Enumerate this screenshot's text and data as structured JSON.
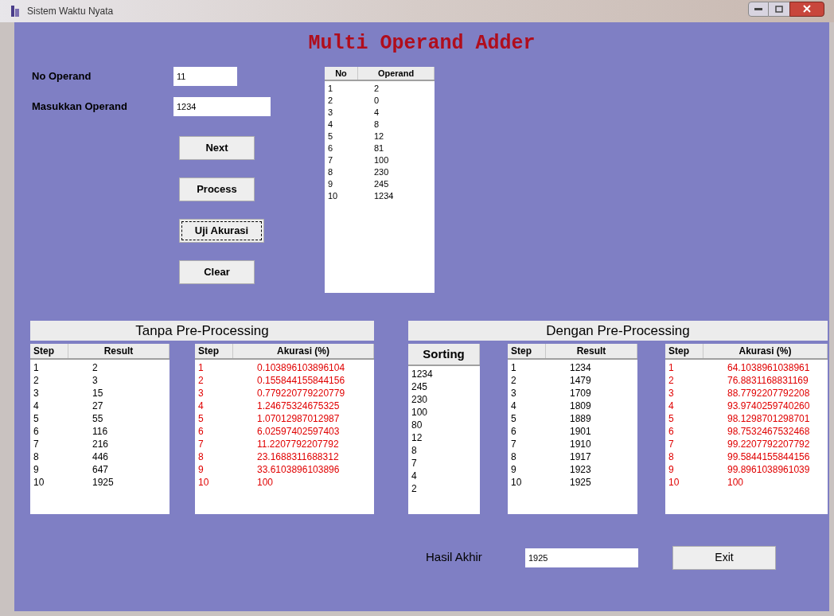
{
  "window": {
    "title": "Sistem Waktu Nyata"
  },
  "title": "Multi Operand Adder",
  "form": {
    "fields": [
      {
        "label": "No Operand",
        "value": "11"
      },
      {
        "label": "Masukkan Operand",
        "value": "1234"
      }
    ],
    "buttons": [
      {
        "label": "Next",
        "focused": false
      },
      {
        "label": "Process",
        "focused": false
      },
      {
        "label": "Uji Akurasi",
        "focused": true
      },
      {
        "label": "Clear",
        "focused": false
      }
    ]
  },
  "operand_list": {
    "columns": [
      "No",
      "Operand"
    ],
    "rows": [
      [
        "1",
        "2"
      ],
      [
        "2",
        "0"
      ],
      [
        "3",
        "4"
      ],
      [
        "4",
        "8"
      ],
      [
        "5",
        "12"
      ],
      [
        "6",
        "81"
      ],
      [
        "7",
        "100"
      ],
      [
        "8",
        "230"
      ],
      [
        "9",
        "245"
      ],
      [
        "10",
        "1234"
      ]
    ]
  },
  "groups": [
    {
      "title": "Tanpa Pre-Processing",
      "tables": [
        {
          "kind": "result",
          "columns": [
            "Step",
            "Result"
          ],
          "rows": [
            [
              "1",
              "2"
            ],
            [
              "2",
              "3"
            ],
            [
              "3",
              "15"
            ],
            [
              "4",
              "27"
            ],
            [
              "5",
              "55"
            ],
            [
              "6",
              "116"
            ],
            [
              "7",
              "216"
            ],
            [
              "8",
              "446"
            ],
            [
              "9",
              "647"
            ],
            [
              "10",
              "1925"
            ]
          ]
        },
        {
          "kind": "accuracy",
          "columns": [
            "Step",
            "Akurasi (%)"
          ],
          "rows": [
            [
              "1",
              "0.103896103896104"
            ],
            [
              "2",
              "0.155844155844156"
            ],
            [
              "3",
              "0.779220779220779"
            ],
            [
              "4",
              "1.24675324675325"
            ],
            [
              "5",
              "1.07012987012987"
            ],
            [
              "6",
              "6.02597402597403"
            ],
            [
              "7",
              "11.2207792207792"
            ],
            [
              "8",
              "23.1688311688312"
            ],
            [
              "9",
              "33.6103896103896"
            ],
            [
              "10",
              "100"
            ]
          ]
        }
      ]
    },
    {
      "title": "Dengan Pre-Processing",
      "tables": [
        {
          "kind": "sorting",
          "columns": [
            "Sorting"
          ],
          "rows": [
            [
              "1234"
            ],
            [
              "245"
            ],
            [
              "230"
            ],
            [
              "100"
            ],
            [
              "80"
            ],
            [
              "12"
            ],
            [
              "8"
            ],
            [
              "7"
            ],
            [
              "4"
            ],
            [
              "2"
            ]
          ]
        },
        {
          "kind": "result",
          "columns": [
            "Step",
            "Result"
          ],
          "rows": [
            [
              "1",
              "1234"
            ],
            [
              "2",
              "1479"
            ],
            [
              "3",
              "1709"
            ],
            [
              "4",
              "1809"
            ],
            [
              "5",
              "1889"
            ],
            [
              "6",
              "1901"
            ],
            [
              "7",
              "1910"
            ],
            [
              "8",
              "1917"
            ],
            [
              "9",
              "1923"
            ],
            [
              "10",
              "1925"
            ]
          ]
        },
        {
          "kind": "accuracy",
          "columns": [
            "Step",
            "Akurasi (%)"
          ],
          "rows": [
            [
              "1",
              "64.1038961038961"
            ],
            [
              "2",
              "76.8831168831169"
            ],
            [
              "3",
              "88.7792207792208"
            ],
            [
              "4",
              "93.9740259740260"
            ],
            [
              "5",
              "98.1298701298701"
            ],
            [
              "6",
              "98.7532467532468"
            ],
            [
              "7",
              "99.2207792207792"
            ],
            [
              "8",
              "99.5844155844156"
            ],
            [
              "9",
              "99.8961038961039"
            ],
            [
              "10",
              "100"
            ]
          ]
        }
      ]
    }
  ],
  "footer": {
    "label": "Hasil Akhir",
    "value": "1925",
    "button": "Exit"
  }
}
